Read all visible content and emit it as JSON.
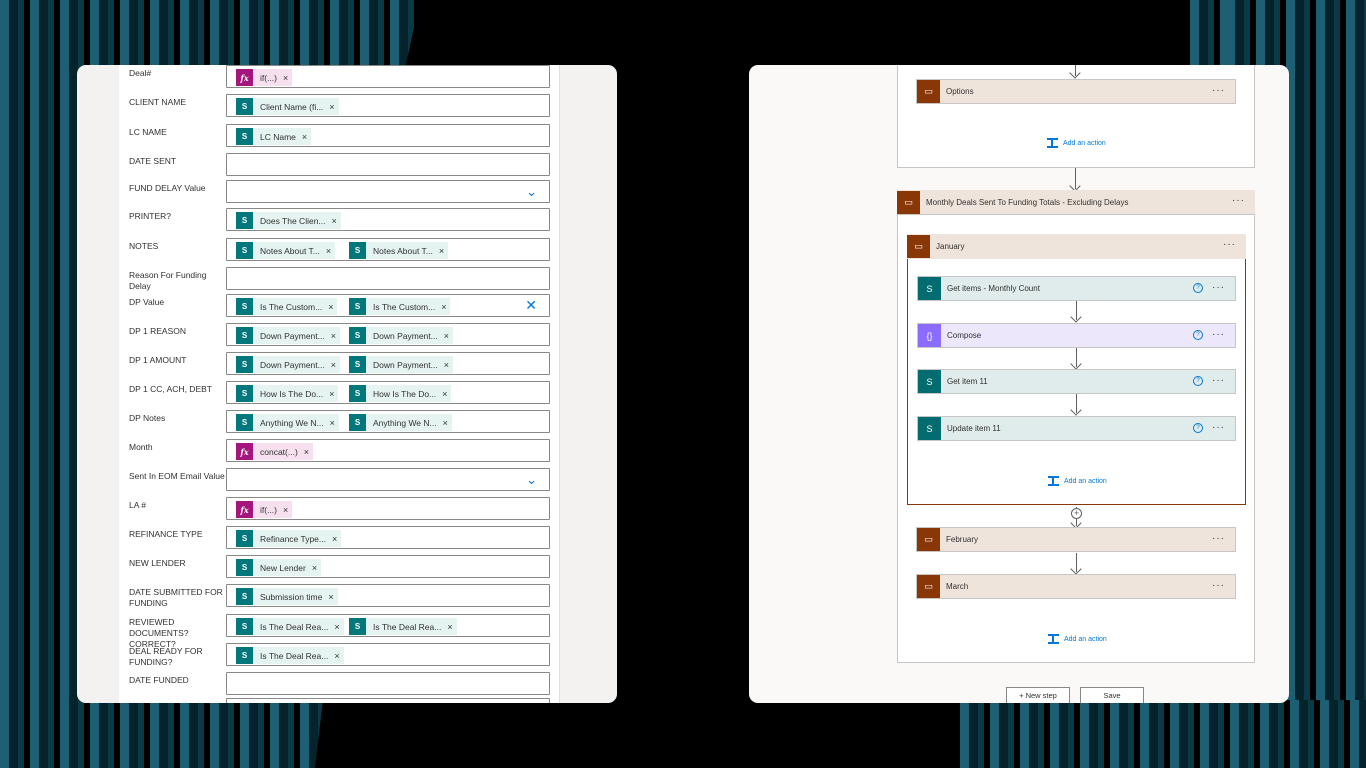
{
  "form": {
    "rows": [
      {
        "label": "Deal#",
        "tokens": [
          {
            "kind": "fx",
            "text": "if(...)"
          }
        ]
      },
      {
        "label": "CLIENT NAME",
        "tokens": [
          {
            "kind": "sp",
            "text": "Client Name (fi..."
          }
        ]
      },
      {
        "label": "LC NAME",
        "tokens": [
          {
            "kind": "sp",
            "text": "LC Name"
          }
        ]
      },
      {
        "label": "DATE SENT",
        "tokens": []
      },
      {
        "label": "FUND DELAY Value",
        "tokens": [],
        "dropdown": true
      },
      {
        "label": "PRINTER?",
        "tokens": [
          {
            "kind": "sp",
            "text": "Does The Clien..."
          }
        ]
      },
      {
        "label": "NOTES",
        "tokens": [
          {
            "kind": "sp",
            "text": "Notes About T..."
          },
          {
            "kind": "sp",
            "text": "Notes About T..."
          }
        ]
      },
      {
        "label": "Reason For Funding Delay",
        "tokens": []
      },
      {
        "label": "DP Value",
        "tokens": [
          {
            "kind": "sp",
            "text": "Is The Custom..."
          },
          {
            "kind": "sp",
            "text": "Is The Custom..."
          }
        ],
        "clear": true
      },
      {
        "label": "DP 1 REASON",
        "tokens": [
          {
            "kind": "sp",
            "text": "Down Payment..."
          },
          {
            "kind": "sp",
            "text": "Down Payment..."
          }
        ]
      },
      {
        "label": "DP 1 AMOUNT",
        "tokens": [
          {
            "kind": "sp",
            "text": "Down Payment..."
          },
          {
            "kind": "sp",
            "text": "Down Payment..."
          }
        ]
      },
      {
        "label": "DP 1 CC, ACH, DEBT",
        "tokens": [
          {
            "kind": "sp",
            "text": "How Is The Do..."
          },
          {
            "kind": "sp",
            "text": "How Is The Do..."
          }
        ]
      },
      {
        "label": "DP Notes",
        "tokens": [
          {
            "kind": "sp",
            "text": "Anything We N..."
          },
          {
            "kind": "sp",
            "text": "Anything We N..."
          }
        ]
      },
      {
        "label": "Month",
        "tokens": [
          {
            "kind": "fx",
            "text": "concat(...)"
          }
        ]
      },
      {
        "label": "Sent In EOM Email Value",
        "tokens": [],
        "dropdown": true
      },
      {
        "label": "LA #",
        "tokens": [
          {
            "kind": "fx",
            "text": "if(...)"
          }
        ]
      },
      {
        "label": "REFINANCE TYPE",
        "tokens": [
          {
            "kind": "sp",
            "text": "Refinance Type..."
          }
        ]
      },
      {
        "label": "NEW LENDER",
        "tokens": [
          {
            "kind": "sp",
            "text": "New Lender"
          }
        ]
      },
      {
        "label": "DATE SUBMITTED FOR FUNDING",
        "tokens": [
          {
            "kind": "sp",
            "text": "Submission time"
          }
        ]
      },
      {
        "label": "REVIEWED DOCUMENTS? CORRECT?",
        "tokens": [
          {
            "kind": "sp",
            "text": "Is The Deal Rea..."
          },
          {
            "kind": "sp",
            "text": "Is The Deal Rea..."
          }
        ]
      },
      {
        "label": "DEAL READY FOR FUNDING?",
        "tokens": [
          {
            "kind": "sp",
            "text": "Is The Deal Rea..."
          }
        ]
      },
      {
        "label": "DATE FUNDED",
        "tokens": []
      }
    ]
  },
  "flow": {
    "options": "Options",
    "add_action": "Add an action",
    "scope_title": "Monthly Deals Sent To Funding Totals - Excluding Delays",
    "january": "January",
    "get_items": "Get items - Monthly Count",
    "compose": "Compose",
    "get_item": "Get item 11",
    "update_item": "Update item 11",
    "february": "February",
    "march": "March",
    "more": "···",
    "new_step": "+ New step",
    "save": "Save"
  },
  "colors": {
    "sharepoint": "#036c70",
    "expression": "#a4167d",
    "control": "#8a3707",
    "compose": "#8c6cff",
    "link": "#0078d4"
  }
}
